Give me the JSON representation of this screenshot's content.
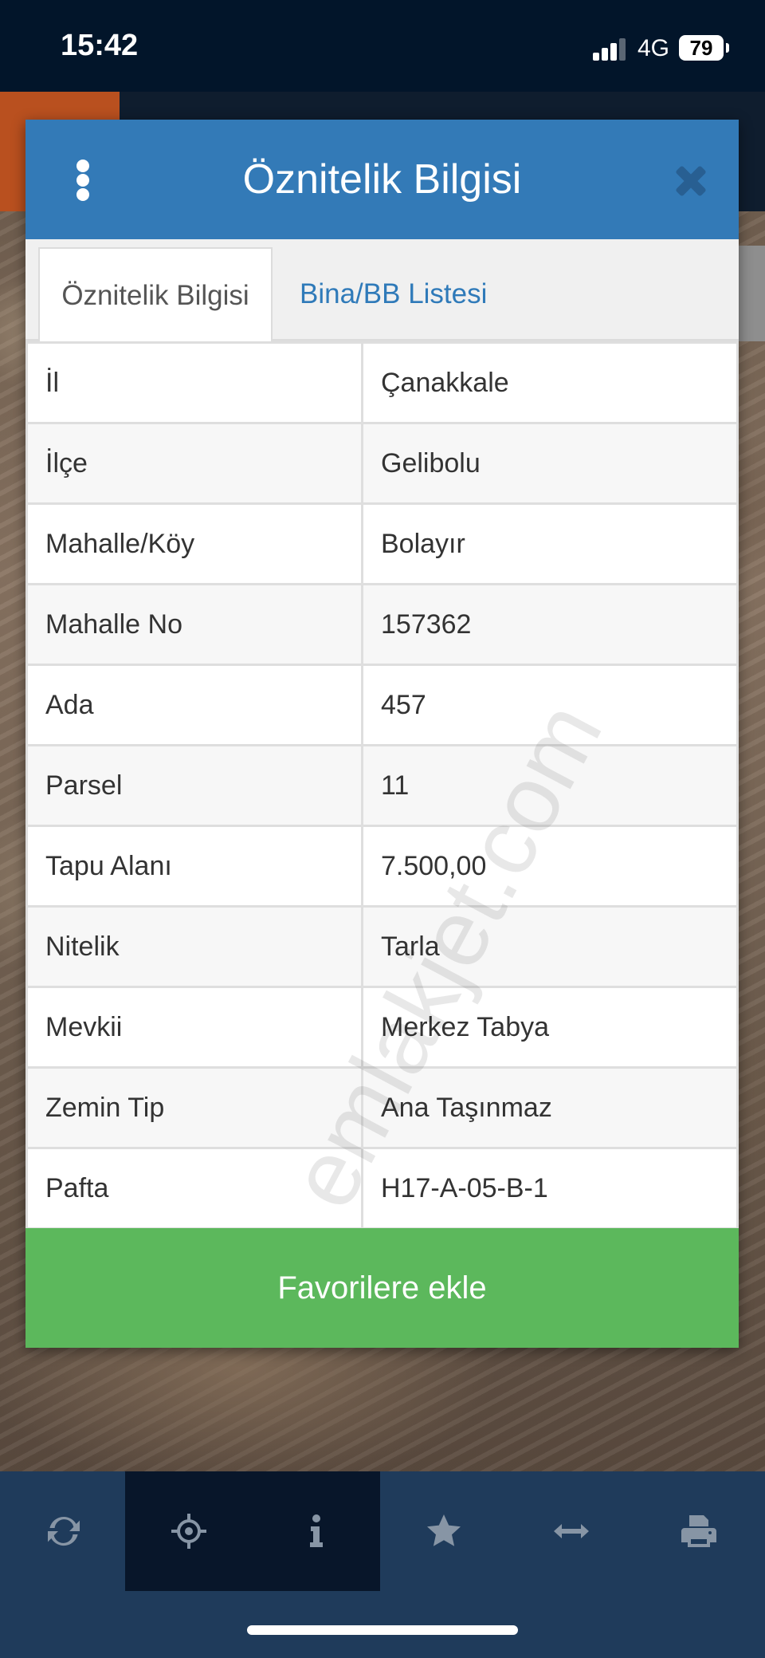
{
  "status_bar": {
    "time": "15:42",
    "network": "4G",
    "battery": "79"
  },
  "modal": {
    "title": "Öznitelik Bilgisi",
    "tabs": [
      {
        "label": "Öznitelik Bilgisi",
        "active": true
      },
      {
        "label": "Bina/BB Listesi",
        "active": false
      }
    ],
    "rows": [
      {
        "key": "İl",
        "value": "Çanakkale"
      },
      {
        "key": "İlçe",
        "value": "Gelibolu"
      },
      {
        "key": "Mahalle/Köy",
        "value": "Bolayır"
      },
      {
        "key": "Mahalle No",
        "value": "157362"
      },
      {
        "key": "Ada",
        "value": "457"
      },
      {
        "key": "Parsel",
        "value": "11"
      },
      {
        "key": "Tapu Alanı",
        "value": "7.500,00"
      },
      {
        "key": "Nitelik",
        "value": "Tarla"
      },
      {
        "key": "Mevkii",
        "value": "Merkez Tabya"
      },
      {
        "key": "Zemin Tip",
        "value": "Ana Taşınmaz"
      },
      {
        "key": "Pafta",
        "value": "H17-A-05-B-1"
      }
    ],
    "favorite_button": "Favorilere ekle",
    "watermark": "emlakjet.com"
  },
  "toolbar": {
    "items": [
      {
        "icon": "refresh-icon"
      },
      {
        "icon": "crosshair-icon"
      },
      {
        "icon": "info-icon"
      },
      {
        "icon": "star-icon"
      },
      {
        "icon": "measure-icon"
      },
      {
        "icon": "print-icon"
      }
    ]
  },
  "colors": {
    "header": "#337ab7",
    "button": "#5cb85c",
    "toolbar": "#1f3b5b",
    "toolbar_active": "#08162a",
    "status_bar": "#02152a"
  }
}
